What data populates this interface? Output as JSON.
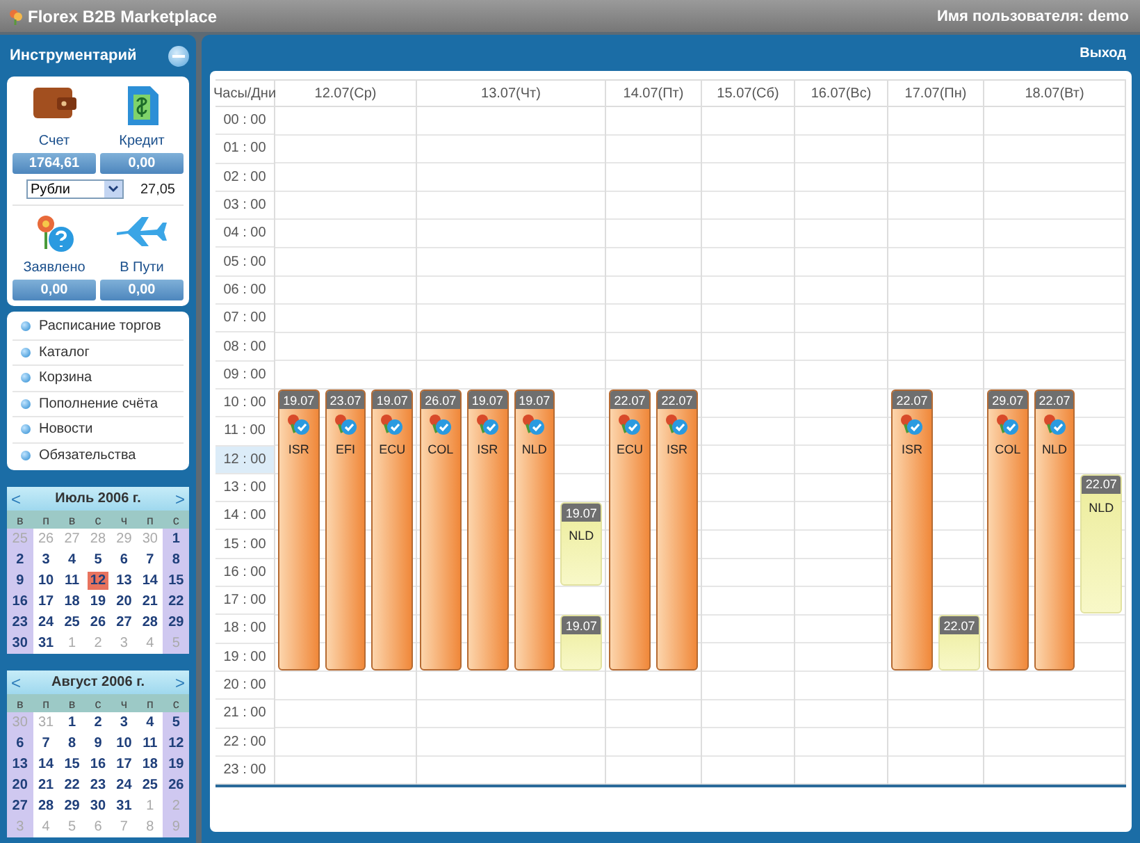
{
  "app": {
    "title": "Florex B2B Marketplace",
    "user": "Имя пользователя: demo"
  },
  "sidebar": {
    "title": "Инструментарий",
    "account": {
      "balance_label": "Счет",
      "balance": "1764,61",
      "credit_label": "Кредит",
      "credit": "0,00",
      "currency": "Рубли",
      "rate": "27,05",
      "declared_label": "Заявлено",
      "declared": "0,00",
      "transit_label": "В Пути",
      "transit": "0,00"
    },
    "menu": [
      "Расписание торгов",
      "Каталог",
      "Корзина",
      "Пополнение счёта",
      "Новости",
      "Обязательства"
    ],
    "calendars": [
      {
        "title": "Июль 2006 г.",
        "prev": "<",
        "next": ">",
        "weekdays": [
          "в",
          "п",
          "в",
          "с",
          "ч",
          "п",
          "с"
        ],
        "weeks": [
          [
            {
              "d": "25",
              "kind": "other"
            },
            {
              "d": "26",
              "kind": "other"
            },
            {
              "d": "27",
              "kind": "other"
            },
            {
              "d": "28",
              "kind": "other"
            },
            {
              "d": "29",
              "kind": "other"
            },
            {
              "d": "30",
              "kind": "other"
            },
            {
              "d": "1",
              "kind": "current"
            }
          ],
          [
            {
              "d": "2",
              "kind": "current"
            },
            {
              "d": "3",
              "kind": "current"
            },
            {
              "d": "4",
              "kind": "current"
            },
            {
              "d": "5",
              "kind": "current"
            },
            {
              "d": "6",
              "kind": "current"
            },
            {
              "d": "7",
              "kind": "current"
            },
            {
              "d": "8",
              "kind": "current"
            }
          ],
          [
            {
              "d": "9",
              "kind": "current"
            },
            {
              "d": "10",
              "kind": "current"
            },
            {
              "d": "11",
              "kind": "current"
            },
            {
              "d": "12",
              "kind": "today"
            },
            {
              "d": "13",
              "kind": "current"
            },
            {
              "d": "14",
              "kind": "current"
            },
            {
              "d": "15",
              "kind": "current"
            }
          ],
          [
            {
              "d": "16",
              "kind": "current"
            },
            {
              "d": "17",
              "kind": "current"
            },
            {
              "d": "18",
              "kind": "current"
            },
            {
              "d": "19",
              "kind": "current"
            },
            {
              "d": "20",
              "kind": "current"
            },
            {
              "d": "21",
              "kind": "current"
            },
            {
              "d": "22",
              "kind": "current"
            }
          ],
          [
            {
              "d": "23",
              "kind": "current"
            },
            {
              "d": "24",
              "kind": "current"
            },
            {
              "d": "25",
              "kind": "current"
            },
            {
              "d": "26",
              "kind": "current"
            },
            {
              "d": "27",
              "kind": "current"
            },
            {
              "d": "28",
              "kind": "current"
            },
            {
              "d": "29",
              "kind": "current"
            }
          ],
          [
            {
              "d": "30",
              "kind": "current"
            },
            {
              "d": "31",
              "kind": "current"
            },
            {
              "d": "1",
              "kind": "other"
            },
            {
              "d": "2",
              "kind": "other"
            },
            {
              "d": "3",
              "kind": "other"
            },
            {
              "d": "4",
              "kind": "other"
            },
            {
              "d": "5",
              "kind": "other"
            }
          ]
        ]
      },
      {
        "title": "Август 2006 г.",
        "prev": "<",
        "next": ">",
        "weekdays": [
          "в",
          "п",
          "в",
          "с",
          "ч",
          "п",
          "с"
        ],
        "weeks": [
          [
            {
              "d": "30",
              "kind": "other"
            },
            {
              "d": "31",
              "kind": "other"
            },
            {
              "d": "1",
              "kind": "current"
            },
            {
              "d": "2",
              "kind": "current"
            },
            {
              "d": "3",
              "kind": "current"
            },
            {
              "d": "4",
              "kind": "current"
            },
            {
              "d": "5",
              "kind": "current"
            }
          ],
          [
            {
              "d": "6",
              "kind": "current"
            },
            {
              "d": "7",
              "kind": "current"
            },
            {
              "d": "8",
              "kind": "current"
            },
            {
              "d": "9",
              "kind": "current"
            },
            {
              "d": "10",
              "kind": "current"
            },
            {
              "d": "11",
              "kind": "current"
            },
            {
              "d": "12",
              "kind": "current"
            }
          ],
          [
            {
              "d": "13",
              "kind": "current"
            },
            {
              "d": "14",
              "kind": "current"
            },
            {
              "d": "15",
              "kind": "current"
            },
            {
              "d": "16",
              "kind": "current"
            },
            {
              "d": "17",
              "kind": "current"
            },
            {
              "d": "18",
              "kind": "current"
            },
            {
              "d": "19",
              "kind": "current"
            }
          ],
          [
            {
              "d": "20",
              "kind": "current"
            },
            {
              "d": "21",
              "kind": "current"
            },
            {
              "d": "22",
              "kind": "current"
            },
            {
              "d": "23",
              "kind": "current"
            },
            {
              "d": "24",
              "kind": "current"
            },
            {
              "d": "25",
              "kind": "current"
            },
            {
              "d": "26",
              "kind": "current"
            }
          ],
          [
            {
              "d": "27",
              "kind": "current"
            },
            {
              "d": "28",
              "kind": "current"
            },
            {
              "d": "29",
              "kind": "current"
            },
            {
              "d": "30",
              "kind": "current"
            },
            {
              "d": "31",
              "kind": "current"
            },
            {
              "d": "1",
              "kind": "other"
            },
            {
              "d": "2",
              "kind": "other"
            }
          ],
          [
            {
              "d": "3",
              "kind": "other"
            },
            {
              "d": "4",
              "kind": "other"
            },
            {
              "d": "5",
              "kind": "other"
            },
            {
              "d": "6",
              "kind": "other"
            },
            {
              "d": "7",
              "kind": "other"
            },
            {
              "d": "8",
              "kind": "other"
            },
            {
              "d": "9",
              "kind": "other"
            }
          ]
        ]
      }
    ]
  },
  "main": {
    "logout": "Выход",
    "schedule": {
      "corner": "Часы/Дни",
      "hours": [
        {
          "label": "00 : 00",
          "current": false
        },
        {
          "label": "01 : 00",
          "current": false
        },
        {
          "label": "02 : 00",
          "current": false
        },
        {
          "label": "03 : 00",
          "current": false
        },
        {
          "label": "04 : 00",
          "current": false
        },
        {
          "label": "05 : 00",
          "current": false
        },
        {
          "label": "06 : 00",
          "current": false
        },
        {
          "label": "07 : 00",
          "current": false
        },
        {
          "label": "08 : 00",
          "current": false
        },
        {
          "label": "09 : 00",
          "current": false
        },
        {
          "label": "10 : 00",
          "current": false
        },
        {
          "label": "11 : 00",
          "current": false
        },
        {
          "label": "12 : 00",
          "current": true
        },
        {
          "label": "13 : 00",
          "current": false
        },
        {
          "label": "14 : 00",
          "current": false
        },
        {
          "label": "15 : 00",
          "current": false
        },
        {
          "label": "16 : 00",
          "current": false
        },
        {
          "label": "17 : 00",
          "current": false
        },
        {
          "label": "18 : 00",
          "current": false
        },
        {
          "label": "19 : 00",
          "current": false
        },
        {
          "label": "20 : 00",
          "current": false
        },
        {
          "label": "21 : 00",
          "current": false
        },
        {
          "label": "22 : 00",
          "current": false
        },
        {
          "label": "23 : 00",
          "current": false
        }
      ],
      "days": [
        {
          "label": "12.07(Ср)",
          "lanes": [
            [
              {
                "kind": "confirmed",
                "date": "19.07",
                "code": "ISR"
              }
            ],
            [
              {
                "kind": "confirmed",
                "date": "23.07",
                "code": "EFI"
              }
            ],
            [
              {
                "kind": "confirmed",
                "date": "19.07",
                "code": "ECU"
              }
            ]
          ]
        },
        {
          "label": "13.07(Чт)",
          "lanes": [
            [
              {
                "kind": "confirmed",
                "date": "26.07",
                "code": "COL"
              }
            ],
            [
              {
                "kind": "confirmed",
                "date": "19.07",
                "code": "ISR"
              }
            ],
            [
              {
                "kind": "confirmed",
                "date": "19.07",
                "code": "NLD"
              }
            ],
            [
              {
                "kind": "pending",
                "date": "19.07",
                "code": "NLD"
              },
              {
                "kind": "pending",
                "date": "19.07"
              }
            ]
          ]
        },
        {
          "label": "14.07(Пт)",
          "lanes": [
            [
              {
                "kind": "confirmed",
                "date": "22.07",
                "code": "ECU"
              }
            ],
            [
              {
                "kind": "confirmed",
                "date": "22.07",
                "code": "ISR"
              }
            ]
          ]
        },
        {
          "label": "15.07(Сб)"
        },
        {
          "label": "16.07(Вс)"
        },
        {
          "label": "17.07(Пн)",
          "lanes": [
            [
              {
                "kind": "confirmed",
                "date": "22.07",
                "code": "ISR"
              }
            ],
            [
              {
                "kind": "pending",
                "date": "22.07"
              }
            ]
          ]
        },
        {
          "label": "18.07(Вт)",
          "lanes": [
            [
              {
                "kind": "confirmed",
                "date": "29.07",
                "code": "COL"
              }
            ],
            [
              {
                "kind": "confirmed",
                "date": "22.07",
                "code": "NLD"
              }
            ],
            [
              {
                "kind": "pending",
                "date": "22.07",
                "code": "NLD"
              }
            ]
          ]
        }
      ]
    }
  }
}
